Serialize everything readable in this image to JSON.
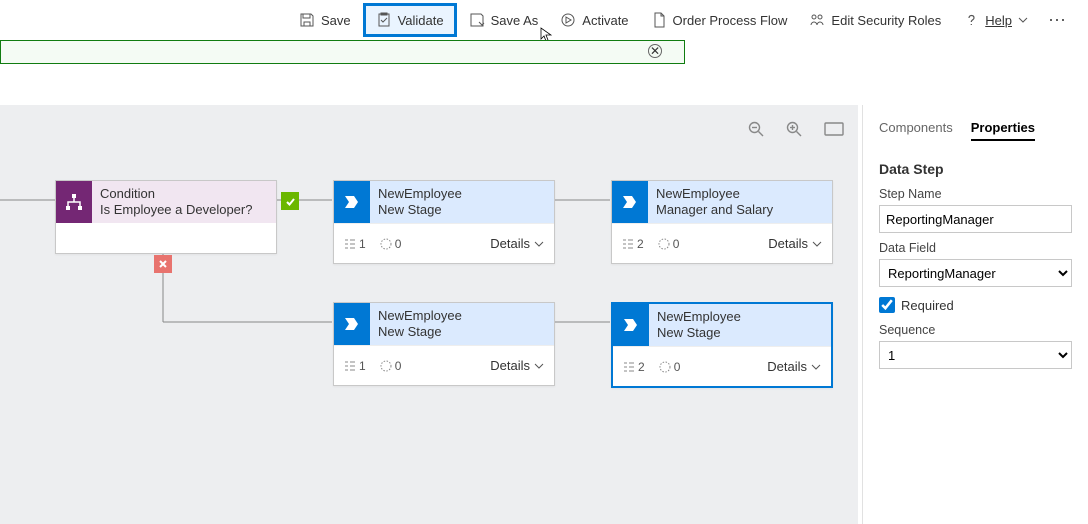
{
  "toolbar": {
    "save": "Save",
    "validate": "Validate",
    "save_as": "Save As",
    "activate": "Activate",
    "order": "Order Process Flow",
    "roles": "Edit Security Roles",
    "help": "Help"
  },
  "banner": {
    "message": ""
  },
  "nodes": {
    "condition": {
      "type": "Condition",
      "subtitle": "Is Employee a Developer?"
    },
    "stage1": {
      "type": "NewEmployee",
      "subtitle": "New Stage",
      "steps": "1",
      "flows": "0"
    },
    "stage2": {
      "type": "NewEmployee",
      "subtitle": "Manager and Salary",
      "steps": "2",
      "flows": "0"
    },
    "stage3": {
      "type": "NewEmployee",
      "subtitle": "New Stage",
      "steps": "1",
      "flows": "0"
    },
    "stage4": {
      "type": "NewEmployee",
      "subtitle": "New Stage",
      "steps": "2",
      "flows": "0"
    },
    "details_label": "Details"
  },
  "panel": {
    "tab_components": "Components",
    "tab_properties": "Properties",
    "heading": "Data Step",
    "step_name_label": "Step Name",
    "step_name_value": "ReportingManager",
    "data_field_label": "Data Field",
    "data_field_value": "ReportingManager",
    "required_label": "Required",
    "required_checked": true,
    "sequence_label": "Sequence",
    "sequence_value": "1"
  }
}
